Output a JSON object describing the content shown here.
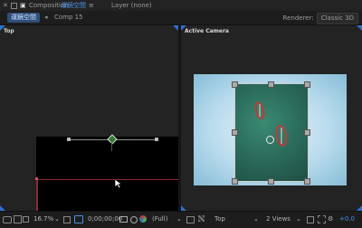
{
  "header": {
    "composition_prefix": "Composition",
    "composition_name": "運鏡空間",
    "menu_glyph": "≡",
    "layer_label": "Layer (none)"
  },
  "tabs": [
    {
      "label": "運鏡空間",
      "active": true
    },
    {
      "label": "Comp 15",
      "active": false
    }
  ],
  "renderer": {
    "label": "Renderer:",
    "value": "Classic 3D"
  },
  "left_view": {
    "label": "Top"
  },
  "right_view": {
    "label": "Active Camera"
  },
  "bottom_bar": {
    "zoom": "16.7%",
    "timecode": "0;00;00;00",
    "resolution": "(Full)",
    "view_name": "Top",
    "view_layout": "2 Views",
    "exposure": "+0.0"
  },
  "colors": {
    "accent": "#2d6fd0",
    "tab_active_bg": "#2d4f7a",
    "comp_name": "#4a90e2",
    "camera_bg_light": "#cde6f4",
    "camera_bg_dark": "#86bdd6",
    "image_green": "#2b6b5b",
    "boat_red": "#c03a3a"
  },
  "icons": {
    "composition": "composition-icon",
    "lock": "lock-icon",
    "camera": "snapshot-icon",
    "color": "color-channel-icon",
    "settings": "settings-icon"
  }
}
